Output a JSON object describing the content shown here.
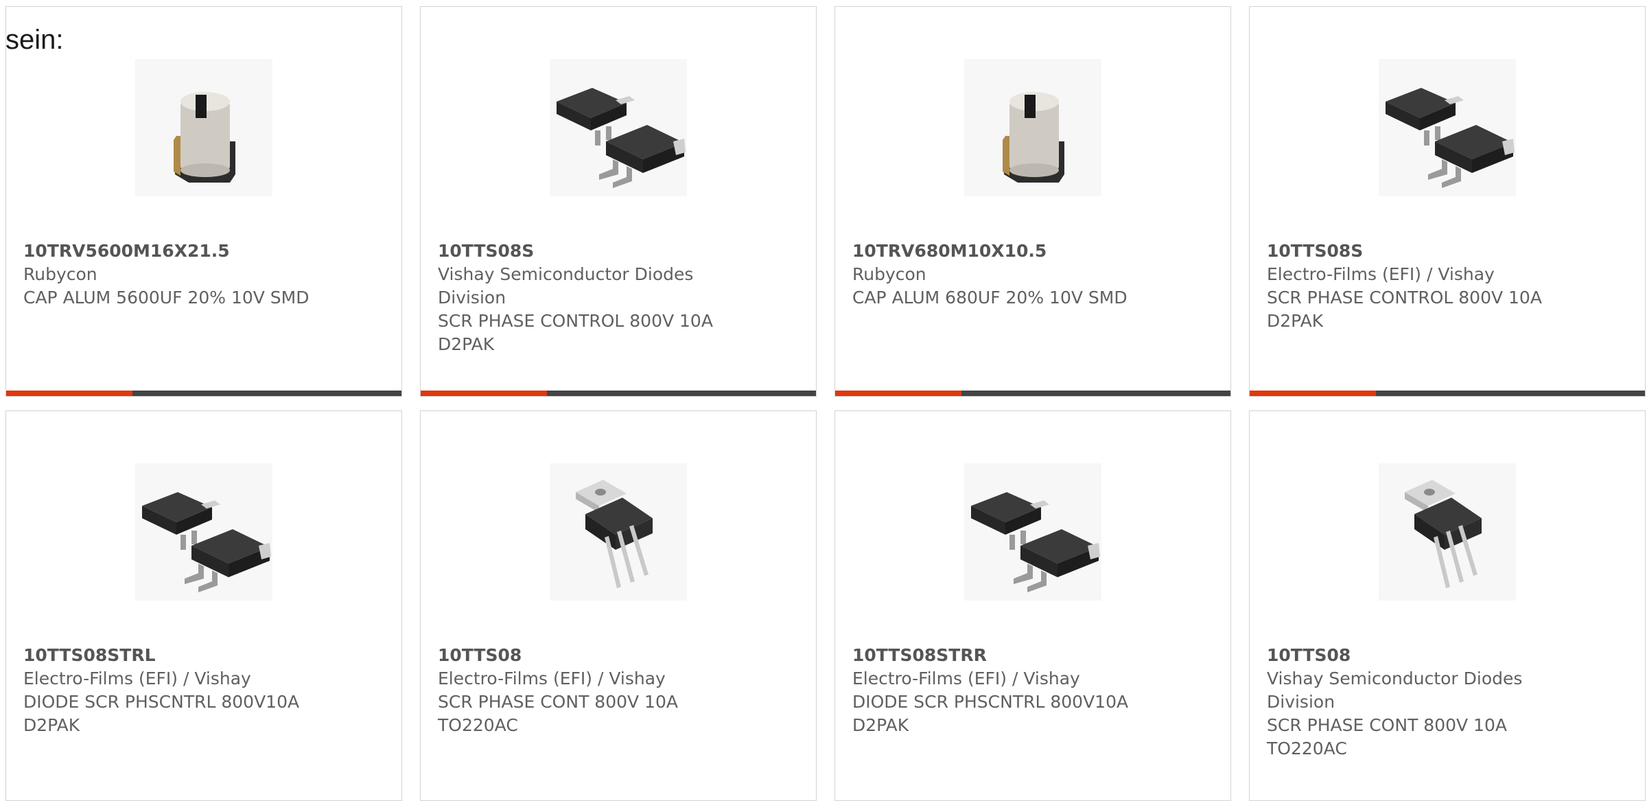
{
  "intro": "sein:",
  "accent_color": "#e0370e",
  "bar_color": "#444444",
  "products": [
    {
      "part": "10TRV5600M16X21.5",
      "maker": "Rubycon",
      "desc": [
        "CAP ALUM 5600UF 20% 10V SMD"
      ],
      "image": "electrolytic-capacitor-smd"
    },
    {
      "part": "10TTS08S",
      "maker": "Vishay Semiconductor Diodes",
      "desc": [
        "Division",
        "SCR PHASE CONTROL 800V 10A",
        "D2PAK"
      ],
      "image": "d2pak-package"
    },
    {
      "part": "10TRV680M10X10.5",
      "maker": "Rubycon",
      "desc": [
        "CAP ALUM 680UF 20% 10V SMD"
      ],
      "image": "electrolytic-capacitor-smd"
    },
    {
      "part": "10TTS08S",
      "maker": "Electro-Films (EFI) / Vishay",
      "desc": [
        "SCR PHASE CONTROL 800V 10A",
        "D2PAK"
      ],
      "image": "d2pak-package"
    },
    {
      "part": "10TTS08STRL",
      "maker": "Electro-Films (EFI) / Vishay",
      "desc": [
        "DIODE SCR PHSCNTRL 800V10A",
        "D2PAK"
      ],
      "image": "d2pak-package"
    },
    {
      "part": "10TTS08",
      "maker": "Electro-Films (EFI) / Vishay",
      "desc": [
        "SCR PHASE CONT 800V 10A",
        "TO220AC"
      ],
      "image": "to220-package"
    },
    {
      "part": "10TTS08STRR",
      "maker": "Electro-Films (EFI) / Vishay",
      "desc": [
        "DIODE SCR PHSCNTRL 800V10A",
        "D2PAK"
      ],
      "image": "d2pak-package"
    },
    {
      "part": "10TTS08",
      "maker": "Vishay Semiconductor Diodes",
      "desc": [
        "Division",
        "SCR PHASE CONT 800V 10A",
        "TO220AC"
      ],
      "image": "to220-package"
    }
  ]
}
